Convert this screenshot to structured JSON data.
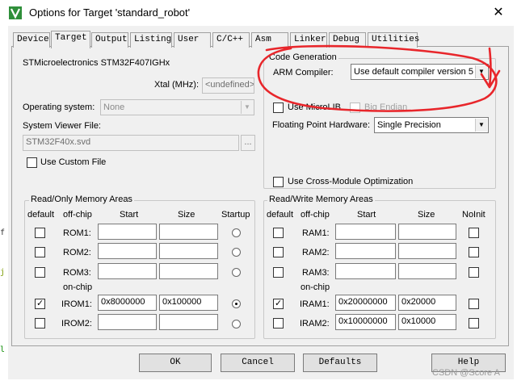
{
  "window": {
    "title": "Options for Target 'standard_robot'",
    "close_glyph": "✕"
  },
  "tabs": [
    "Device",
    "Target",
    "Output",
    "Listing",
    "User",
    "C/C++",
    "Asm",
    "Linker",
    "Debug",
    "Utilities"
  ],
  "active_tab": "Target",
  "target": {
    "device": "STMicroelectronics STM32F407IGHx",
    "xtal_label": "Xtal (MHz):",
    "xtal_value": "<undefined>",
    "os_label": "Operating system:",
    "os_value": "None",
    "svd_label": "System Viewer File:",
    "svd_value": "STM32F40x.svd",
    "browse_label": "...",
    "use_custom_file": "Use Custom File"
  },
  "code_generation": {
    "title": "Code Generation",
    "arm_compiler_label": "ARM Compiler:",
    "arm_compiler_value": "Use default compiler version 5",
    "use_microlib": "Use MicroLIB",
    "big_endian": "Big Endian",
    "fph_label": "Floating Point Hardware:",
    "fph_value": "Single Precision",
    "cross_module": "Use Cross-Module Optimization"
  },
  "ro_memory": {
    "title": "Read/Only Memory Areas",
    "headers": {
      "default": "default",
      "offchip": "off-chip",
      "start": "Start",
      "size": "Size",
      "extra": "Startup"
    },
    "onchip_label": "on-chip",
    "rows": [
      {
        "name": "ROM1:",
        "start": "",
        "size": "",
        "default": false,
        "selected": false
      },
      {
        "name": "ROM2:",
        "start": "",
        "size": "",
        "default": false,
        "selected": false
      },
      {
        "name": "ROM3:",
        "start": "",
        "size": "",
        "default": false,
        "selected": false
      },
      {
        "name": "IROM1:",
        "start": "0x8000000",
        "size": "0x100000",
        "default": true,
        "selected": true
      },
      {
        "name": "IROM2:",
        "start": "",
        "size": "",
        "default": false,
        "selected": false
      }
    ]
  },
  "rw_memory": {
    "title": "Read/Write Memory Areas",
    "headers": {
      "default": "default",
      "offchip": "off-chip",
      "start": "Start",
      "size": "Size",
      "extra": "NoInit"
    },
    "onchip_label": "on-chip",
    "rows": [
      {
        "name": "RAM1:",
        "start": "",
        "size": "",
        "default": false,
        "noinit": false
      },
      {
        "name": "RAM2:",
        "start": "",
        "size": "",
        "default": false,
        "noinit": false
      },
      {
        "name": "RAM3:",
        "start": "",
        "size": "",
        "default": false,
        "noinit": false
      },
      {
        "name": "IRAM1:",
        "start": "0x20000000",
        "size": "0x20000",
        "default": true,
        "noinit": false
      },
      {
        "name": "IRAM2:",
        "start": "0x10000000",
        "size": "0x10000",
        "default": false,
        "noinit": false
      }
    ]
  },
  "buttons": {
    "ok": "OK",
    "cancel": "Cancel",
    "defaults": "Defaults",
    "help": "Help"
  },
  "checkmark": "✓",
  "watermark": "CSDN @Score A",
  "left_strip_chars": [
    "f",
    "j",
    "l"
  ],
  "colors": {
    "annotation": "#e8262b",
    "arrow_dark": "#333333"
  }
}
